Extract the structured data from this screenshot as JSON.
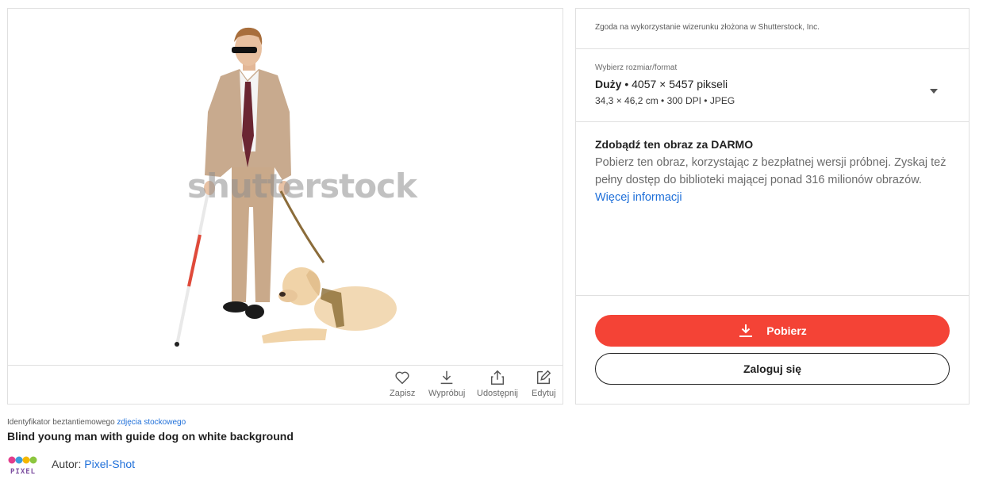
{
  "image": {
    "watermark": "shutterstock",
    "alt": "Blind young man with guide dog on white background"
  },
  "actions": [
    {
      "label": "Zapisz",
      "icon": "heart-icon"
    },
    {
      "label": "Wypróbuj",
      "icon": "download-icon"
    },
    {
      "label": "Udostępnij",
      "icon": "share-icon"
    },
    {
      "label": "Edytuj",
      "icon": "edit-icon"
    }
  ],
  "consent_text": "Zgoda na wykorzystanie wizerunku złożona w Shutterstock, Inc.",
  "size_select": {
    "caption": "Wybierz rozmiar/format",
    "size_name": "Duży",
    "dimensions": "• 4057 × 5457 pikseli",
    "details": "34,3 × 46,2 cm • 300 DPI • JPEG"
  },
  "free_offer": {
    "title": "Zdobądź ten obraz za DARMO",
    "text": "Pobierz ten obraz, korzystając z bezpłatnej wersji próbnej. Zyskaj też pełny dostęp do biblioteki mającej ponad 316 milionów obrazów.",
    "link": "Więcej informacji"
  },
  "buttons": {
    "download": "Pobierz",
    "login": "Zaloguj się"
  },
  "meta": {
    "id_label": "Identyfikator beztantiemowego",
    "id_link": "zdjęcia stockowego",
    "title": "Blind young man with guide dog on white background",
    "author_label": "Autor:",
    "author_name": "Pixel-Shot",
    "author_logo_text": "PIXEL"
  },
  "colors": {
    "accent": "#f44336",
    "link": "#1e6fd9",
    "border": "#e0e0e0"
  }
}
